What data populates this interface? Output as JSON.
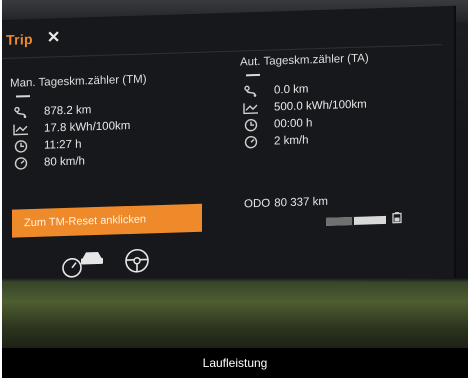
{
  "tab": {
    "title": "Trip",
    "close": "✕"
  },
  "left_panel": {
    "title": "Man. Tageskm.zähler (TM)",
    "distance": "878.2 km",
    "consumption": "17.8 kWh/100km",
    "time": "11:27 h",
    "speed": "80 km/h"
  },
  "right_panel": {
    "title": "Aut. Tageskm.zähler (TA)",
    "distance": "0.0 km",
    "consumption": "500.0 kWh/100km",
    "time": "00:00 h",
    "speed": "2 km/h"
  },
  "reset_button": "Zum TM-Reset anklicken",
  "odo": {
    "label": "ODO",
    "value": "80 337 km"
  },
  "charge_level": 0.45,
  "caption": "Laufleistung",
  "colors": {
    "accent": "#ef8a2a",
    "screen": "#17181c"
  }
}
